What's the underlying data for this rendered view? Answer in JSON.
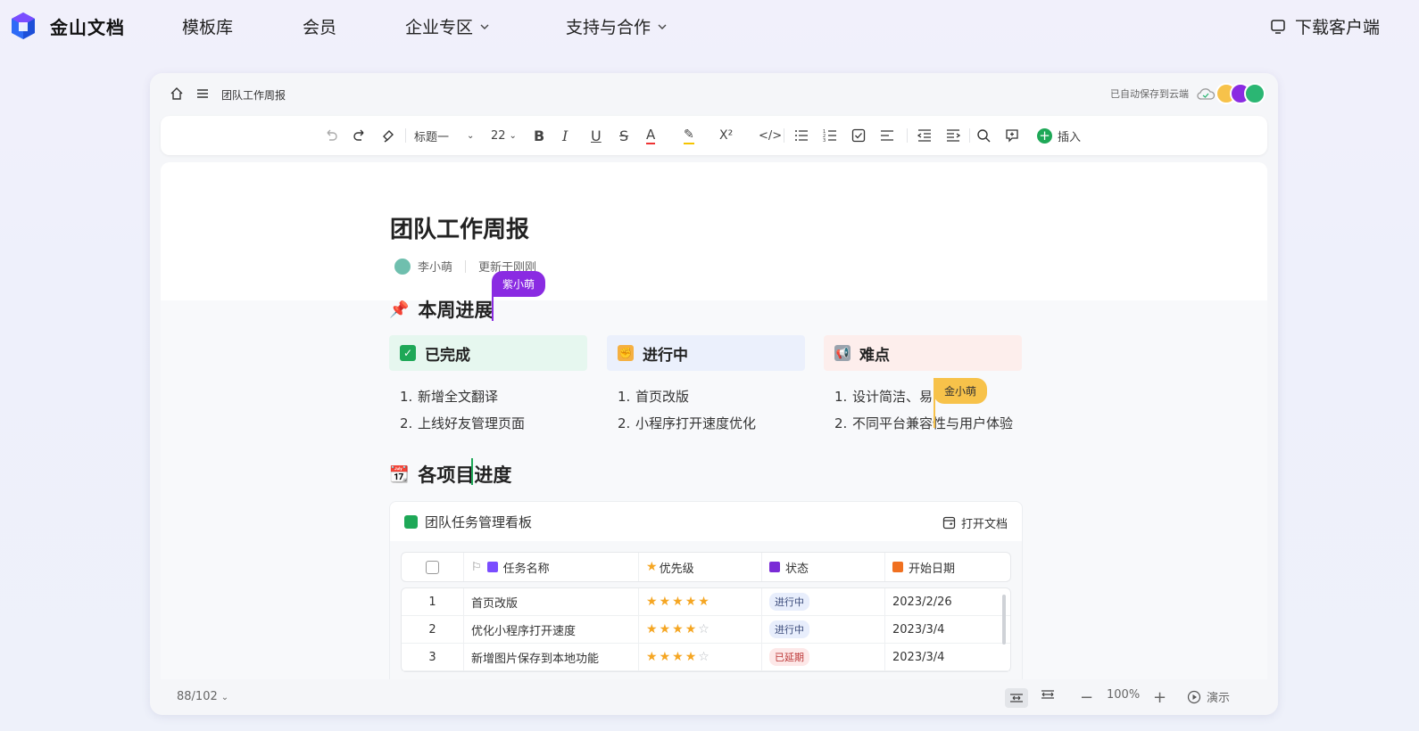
{
  "site": {
    "brand": "金山文档",
    "nav": [
      "模板库",
      "会员",
      "企业专区",
      "支持与合作"
    ],
    "download": "下载客户端"
  },
  "doc_header": {
    "doc_name": "团队工作周报",
    "saved": "已自动保存到云端"
  },
  "toolbar": {
    "style": "标题一",
    "size": "22",
    "insert": "插入"
  },
  "doc": {
    "title": "团队工作周报",
    "author": "李小萌",
    "updated": "更新于刚刚",
    "section1": "本周进展",
    "section2": "各项目进度",
    "cursor1": "紫小萌",
    "cursor2": "金小萌",
    "columns": [
      {
        "title": "已完成",
        "items": [
          "新增全文翻译",
          "上线好友管理页面"
        ]
      },
      {
        "title": "进行中",
        "items": [
          "首页改版",
          "小程序打开速度优化"
        ]
      },
      {
        "title": "难点",
        "items": [
          "设计简洁、易",
          "不同平台兼容性与用户体验"
        ]
      }
    ],
    "board": {
      "title": "团队任务管理看板",
      "open": "打开文档",
      "headers": [
        "任务名称",
        "优先级",
        "状态",
        "开始日期"
      ],
      "rows": [
        {
          "n": "1",
          "name": "首页改版",
          "stars": 5,
          "status": "进行中",
          "date": "2023/2/26"
        },
        {
          "n": "2",
          "name": "优化小程序打开速度",
          "stars": 4,
          "status": "进行中",
          "date": "2023/3/4"
        },
        {
          "n": "3",
          "name": "新增图片保存到本地功能",
          "stars": 4,
          "status": "已延期",
          "date": "2023/3/4"
        }
      ]
    }
  },
  "status": {
    "wordcount": "88/102",
    "zoom": "100%",
    "present": "演示"
  },
  "colors": {
    "purple_cursor": "#8a2be2",
    "gold_cursor": "#f7c24a",
    "done_bg": "#e6f7ef",
    "prog_bg": "#ebf0fc",
    "hard_bg": "#fdeeec"
  }
}
